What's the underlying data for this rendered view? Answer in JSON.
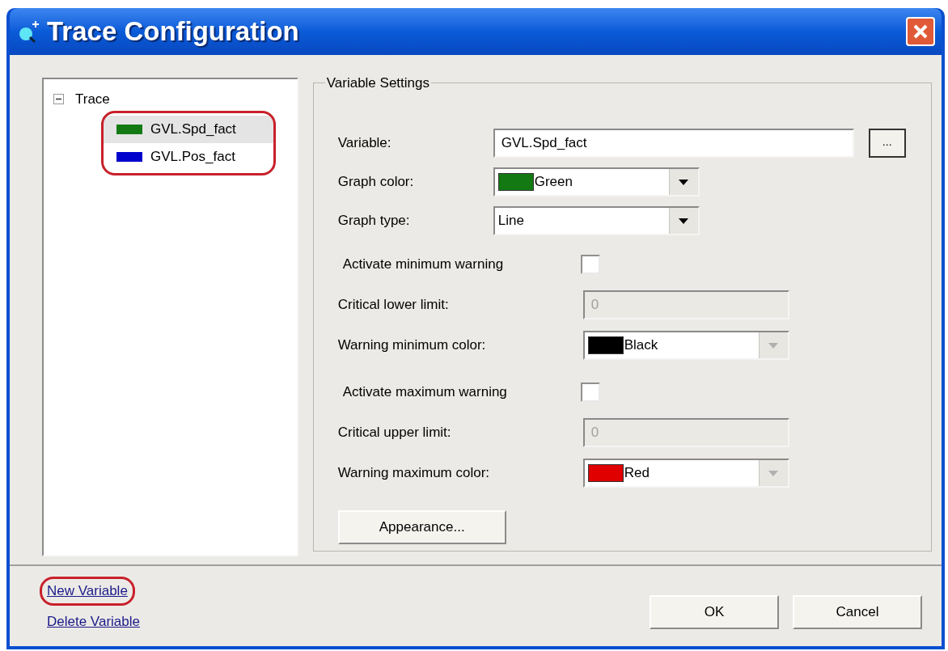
{
  "window": {
    "title": "Trace Configuration"
  },
  "tree": {
    "label": "Trace",
    "expanded": true,
    "children_annotated": true,
    "children": [
      {
        "label": "GVL.Spd_fact",
        "color": "#137a13",
        "selected": true
      },
      {
        "label": "GVL.Pos_fact",
        "color": "#0000cc",
        "selected": false
      }
    ]
  },
  "variable_settings": {
    "title": "Variable Settings",
    "main_fields": [
      {
        "kind": "text",
        "label": "Variable:",
        "value": "GVL.Spd_fact",
        "button": "...",
        "disabled": false
      },
      {
        "kind": "color_select",
        "label": "Graph color:",
        "value": "Green",
        "color": "#137a13",
        "disabled": false
      },
      {
        "kind": "select",
        "label": "Graph type:",
        "value": "Line",
        "disabled": false
      }
    ],
    "warning_fields": [
      {
        "kind": "checkbox",
        "label": "Activate minimum warning",
        "checked": false
      },
      {
        "kind": "text",
        "label": "Critical lower limit:",
        "value": "0",
        "disabled": true
      },
      {
        "kind": "color_select",
        "label": "Warning minimum color:",
        "value": "Black",
        "color": "#000000",
        "disabled": true
      },
      {
        "kind": "checkbox",
        "label": "Activate maximum warning",
        "checked": false
      },
      {
        "kind": "text",
        "label": "Critical upper limit:",
        "value": "0",
        "disabled": true
      },
      {
        "kind": "color_select",
        "label": "Warning maximum color:",
        "value": "Red",
        "color": "#e00000",
        "disabled": true
      }
    ],
    "appearance_button": "Appearance..."
  },
  "links": [
    {
      "label": "New Variable",
      "annotated": true
    },
    {
      "label": "Delete Variable",
      "annotated": false
    }
  ],
  "buttons": [
    "OK",
    "Cancel"
  ]
}
